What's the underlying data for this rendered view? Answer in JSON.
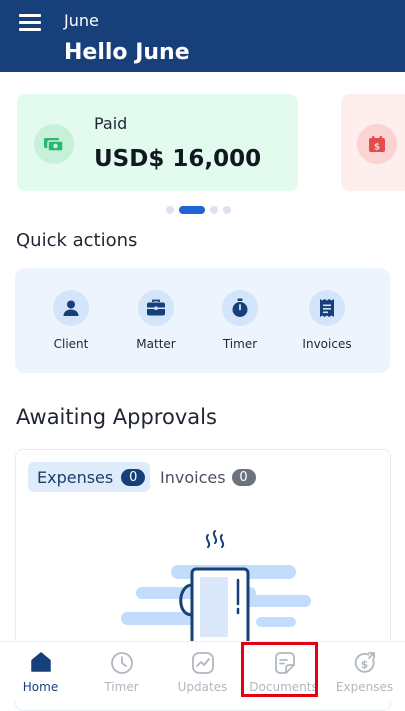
{
  "header": {
    "user_name": "June",
    "greeting": "Hello June",
    "background_color": "#173f7a"
  },
  "summary_cards": [
    {
      "label": "Paid",
      "amount": "USD$ 16,000",
      "icon": "money-icon",
      "color": "#e3fbee"
    },
    {
      "icon": "calendar-dollar-icon",
      "color": "#feeeee"
    }
  ],
  "pager": {
    "count": 4,
    "active_index": 1
  },
  "quick_actions": {
    "title": "Quick actions",
    "items": [
      {
        "label": "Client",
        "icon": "person-icon"
      },
      {
        "label": "Matter",
        "icon": "briefcase-icon"
      },
      {
        "label": "Timer",
        "icon": "stopwatch-icon"
      },
      {
        "label": "Invoices",
        "icon": "invoice-icon"
      }
    ]
  },
  "awaiting_approvals": {
    "title": "Awaiting Approvals",
    "tabs": [
      {
        "label": "Expenses",
        "count": "0",
        "selected": true
      },
      {
        "label": "Invoices",
        "count": "0",
        "selected": false
      }
    ],
    "illustration": "coffee-mug-illustration"
  },
  "bottom_nav": {
    "items": [
      {
        "label": "Home",
        "icon": "home-icon",
        "active": true
      },
      {
        "label": "Timer",
        "icon": "clock-icon",
        "active": false
      },
      {
        "label": "Updates",
        "icon": "trend-icon",
        "active": false
      },
      {
        "label": "Documents",
        "icon": "document-icon",
        "active": false,
        "highlighted": true
      },
      {
        "label": "Expenses",
        "icon": "expense-icon",
        "active": false
      }
    ],
    "active_color": "#173f7a",
    "inactive_color": "#b1b7c1"
  },
  "highlight_color": "#e60012"
}
